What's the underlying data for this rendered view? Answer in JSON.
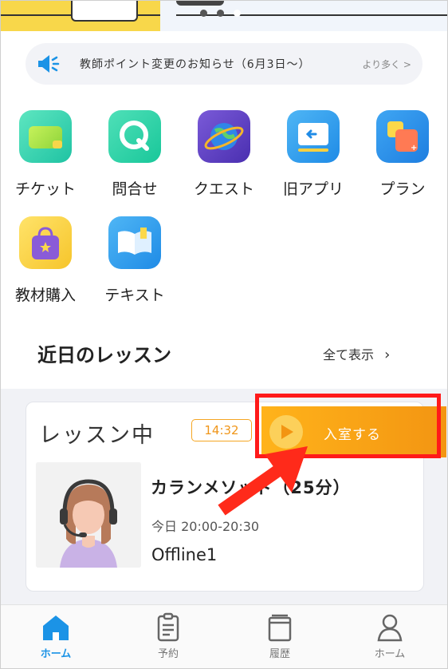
{
  "carousel": {
    "dot_count": 3,
    "active_index": 2
  },
  "notice": {
    "text": "教師ポイント変更のお知らせ（6月3日〜）",
    "more": "より多く >"
  },
  "menu": [
    {
      "label": "チケット",
      "icon": "ticket-icon"
    },
    {
      "label": "問合せ",
      "icon": "inquiry-icon"
    },
    {
      "label": "クエスト",
      "icon": "quest-icon"
    },
    {
      "label": "旧アプリ",
      "icon": "old-app-icon"
    },
    {
      "label": "プラン",
      "icon": "plan-icon"
    },
    {
      "label": "教材購入",
      "icon": "shopping-bag-icon"
    },
    {
      "label": "テキスト",
      "icon": "book-icon"
    }
  ],
  "section": {
    "title": "近日のレッスン",
    "show_all": "全て表示"
  },
  "lesson": {
    "status": "レッスン中",
    "timer": "14:32",
    "enter_label": "入室する",
    "course": "カランメソッド（25分）",
    "time": "今日 20:00-20:30",
    "teacher": "Offline1"
  },
  "nav": [
    {
      "label": "ホーム",
      "icon": "home-icon",
      "active": true
    },
    {
      "label": "予約",
      "icon": "clipboard-icon",
      "active": false
    },
    {
      "label": "履歴",
      "icon": "history-icon",
      "active": false
    },
    {
      "label": "ホーム",
      "icon": "person-icon",
      "active": false
    }
  ],
  "colors": {
    "accent": "#1b93e6",
    "orange": "#f39512",
    "highlight": "#ff1a1a"
  }
}
